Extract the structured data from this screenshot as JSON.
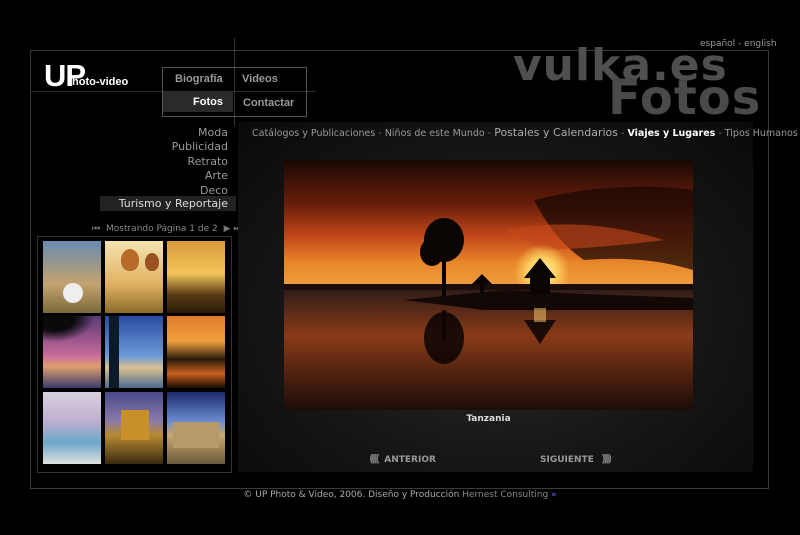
{
  "language": {
    "es": "español",
    "sep": "-",
    "en": "english"
  },
  "brand": {
    "name": "vulka.es",
    "sub": "Fotos"
  },
  "logo": {
    "up": "UP",
    "rest": "hoto-video"
  },
  "nav": {
    "biografia": "Biografía",
    "videos": "Videos",
    "fotos": "Fotos",
    "contactar": "Contactar"
  },
  "categories": [
    "Moda",
    "Publicidad",
    "Retrato",
    "Arte",
    "Deco"
  ],
  "active_category": "Turismo y Reportaje",
  "pager": {
    "text": "Mostrando Página 1 de 2"
  },
  "breadcrumbs": {
    "items": [
      "Catálogos y Publicaciones",
      "Niños de este Mundo",
      "Postales y Calendarios",
      "Viajes y Lugares",
      "Tipos Humanos"
    ],
    "sep": " - "
  },
  "photo": {
    "caption": "Tanzania"
  },
  "buttons": {
    "prev": "ANTERIOR",
    "next": "SIGUIENTE"
  },
  "footer": {
    "text": "© UP Photo & Video, 2006. Diseño y Producción",
    "link": "Hernest Consulting",
    "arrow": "»"
  },
  "colors": {
    "background": "#000000",
    "accent_sunset": "#d9531b",
    "active_link": "#ffffff"
  }
}
